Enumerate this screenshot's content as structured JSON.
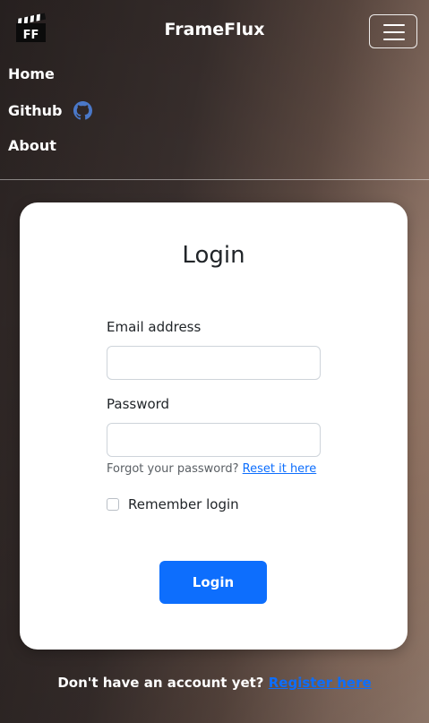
{
  "navbar": {
    "brand": "FrameFlux",
    "logo_text": "FF",
    "menu_icon": "hamburger-menu-icon",
    "links": [
      {
        "label": "Home"
      },
      {
        "label": "Github",
        "icon": "github-icon"
      },
      {
        "label": "About"
      }
    ]
  },
  "login_card": {
    "title": "Login",
    "email_label": "Email address",
    "email_value": "",
    "password_label": "Password",
    "password_value": "",
    "forgot_text": "Forgot your password?",
    "reset_link": "Reset it here",
    "remember_label": "Remember login",
    "remember_checked": false,
    "submit_label": "Login"
  },
  "footer": {
    "prompt": "Don't have an account yet?",
    "register_link": "Register here"
  },
  "colors": {
    "primary": "#0d6efd",
    "card_bg": "#ffffff"
  }
}
